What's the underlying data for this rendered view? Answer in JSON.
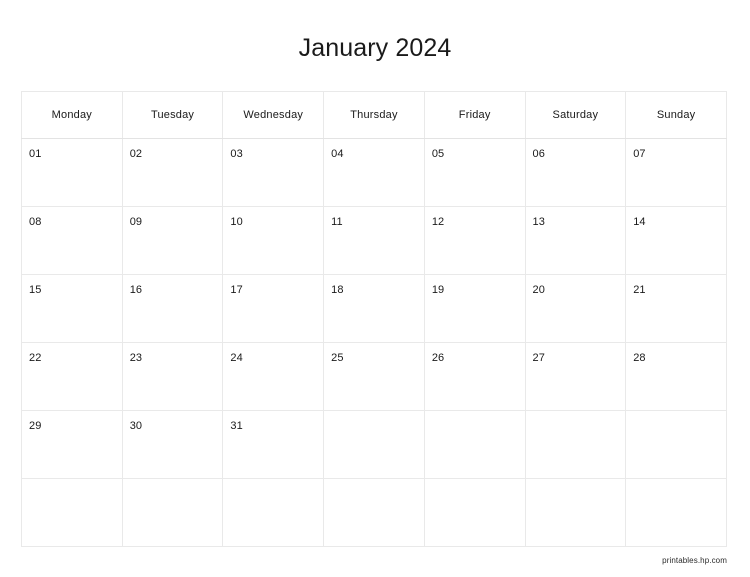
{
  "calendar": {
    "title": "January 2024",
    "weekday_headers": [
      "Monday",
      "Tuesday",
      "Wednesday",
      "Thursday",
      "Friday",
      "Saturday",
      "Sunday"
    ],
    "weeks": [
      [
        "01",
        "02",
        "03",
        "04",
        "05",
        "06",
        "07"
      ],
      [
        "08",
        "09",
        "10",
        "11",
        "12",
        "13",
        "14"
      ],
      [
        "15",
        "16",
        "17",
        "18",
        "19",
        "20",
        "21"
      ],
      [
        "22",
        "23",
        "24",
        "25",
        "26",
        "27",
        "28"
      ],
      [
        "29",
        "30",
        "31",
        "",
        "",
        "",
        ""
      ],
      [
        "",
        "",
        "",
        "",
        "",
        "",
        ""
      ]
    ]
  },
  "footer": {
    "credit": "printables.hp.com"
  },
  "colors": {
    "text": "#1a1a1a",
    "grid_border": "#e9e9e9",
    "background": "#ffffff",
    "footer_text": "#2b2b2b"
  }
}
